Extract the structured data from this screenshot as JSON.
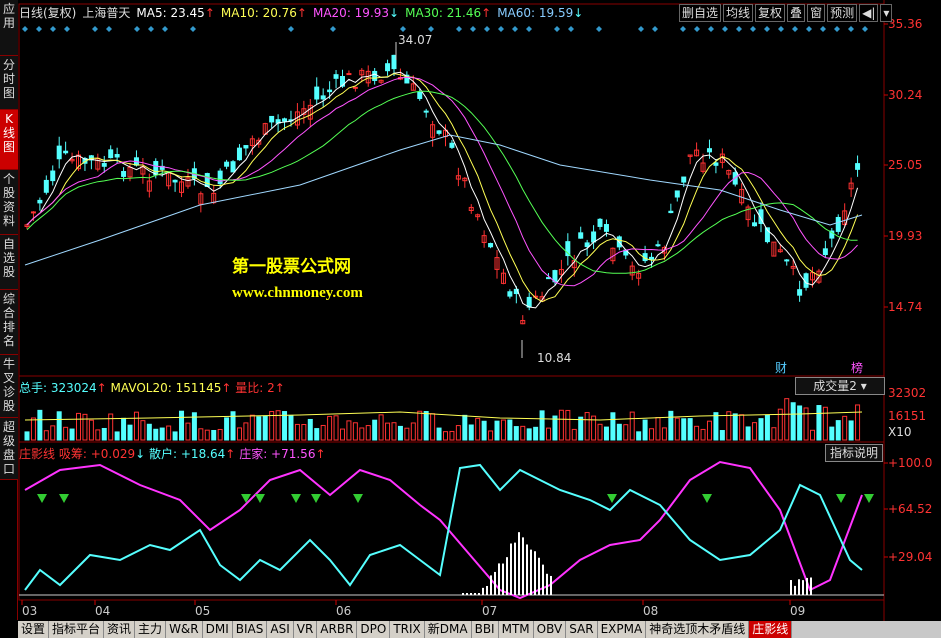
{
  "sidebar": {
    "tabs": [
      "应用",
      "分时图",
      "K线图",
      "个股资料",
      "自选股",
      "综合排名",
      "牛叉诊股",
      "超级盘口"
    ],
    "active": 2
  },
  "header": {
    "mode": "日线(复权)",
    "stock": "上海普天",
    "ma5": "MA5: 23.45",
    "ma10": "MA10: 20.76",
    "ma20": "MA20: 19.93",
    "ma30": "MA30: 21.46",
    "ma60": "MA60: 19.59"
  },
  "toolbar": [
    "删自选",
    "均线",
    "复权",
    "叠",
    "窗",
    "预测"
  ],
  "price_axis": [
    "35.36",
    "30.24",
    "25.05",
    "19.93",
    "14.74"
  ],
  "annotations": {
    "high": "34.07",
    "low": "10.84",
    "ji": "财",
    "bang": "榜"
  },
  "watermark": {
    "line1": "第一股票公式网",
    "line2": "www.chnmoney.com"
  },
  "volume": {
    "label1": "总手: 323024",
    "label2": "MAVOL20: 151145",
    "label3": "量比: 2",
    "selector": "成交量2",
    "axis": [
      "32302",
      "16151",
      "X10"
    ]
  },
  "indicator": {
    "name": "庄影线",
    "l1": "吸筹: +0.029",
    "l2": "散户: +18.64",
    "l3": "庄家: +71.56",
    "button": "指标说明",
    "axis": [
      "+100.0",
      "+64.52",
      "+29.04"
    ]
  },
  "months": [
    "03",
    "04",
    "05",
    "06",
    "07",
    "08",
    "09"
  ],
  "bottom_tabs": [
    "设置",
    "指标平台",
    "资讯",
    "主力",
    "W&R",
    "DMI",
    "BIAS",
    "ASI",
    "VR",
    "ARBR",
    "DPO",
    "TRIX",
    "新DMA",
    "BBI",
    "MTM",
    "OBV",
    "SAR",
    "EXPMA",
    "神奇选顶木矛盾线",
    "庄影线"
  ],
  "active_bottom": 19,
  "colors": {
    "up": "#ff3232",
    "down": "#54ffff",
    "ma5": "#ffffff",
    "ma10": "#ffff54",
    "ma20": "#ff54ff",
    "ma30": "#54ff54",
    "ma60": "#a0d8ff"
  }
}
